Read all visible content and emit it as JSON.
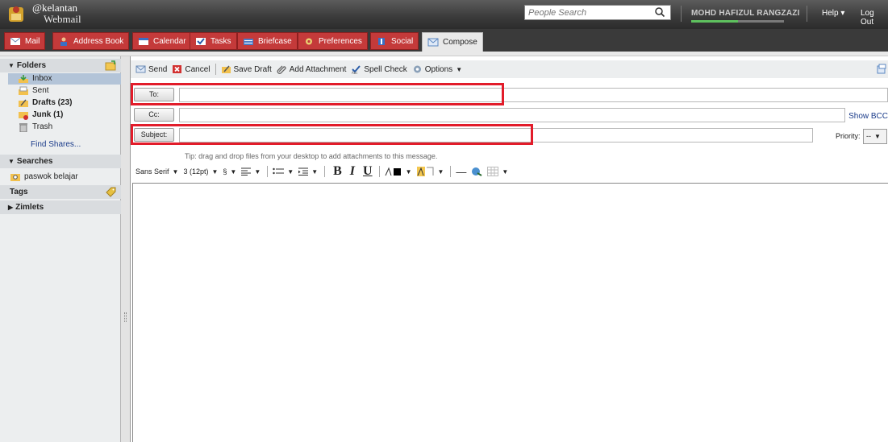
{
  "header": {
    "brand_line1": "@kelantan",
    "brand_line2": "Webmail",
    "people_search_placeholder": "People Search",
    "username": "MOHD HAFIZUL RANGZAZI",
    "quota_fraction": 0.5,
    "help_label": "Help ▾",
    "logout_label": "Log Out"
  },
  "tabs": [
    {
      "label": "Mail",
      "icon": "mail-icon"
    },
    {
      "label": "Address Book",
      "icon": "address-book-icon"
    },
    {
      "label": "Calendar",
      "icon": "calendar-icon"
    },
    {
      "label": "Tasks",
      "icon": "tasks-icon"
    },
    {
      "label": "Briefcase",
      "icon": "briefcase-icon"
    },
    {
      "label": "Preferences",
      "icon": "gear-icon"
    },
    {
      "label": "Social",
      "icon": "social-icon"
    },
    {
      "label": "Compose",
      "icon": "compose-icon",
      "active": true
    }
  ],
  "sidebar": {
    "folders_header": "Folders",
    "folders": [
      {
        "label": "Inbox",
        "icon": "inbox-icon",
        "selected": true
      },
      {
        "label": "Sent",
        "icon": "sent-icon"
      },
      {
        "label": "Drafts (23)",
        "icon": "drafts-icon",
        "bold": true
      },
      {
        "label": "Junk (1)",
        "icon": "junk-icon",
        "bold": true
      },
      {
        "label": "Trash",
        "icon": "trash-icon"
      }
    ],
    "find_shares": "Find Shares...",
    "searches_header": "Searches",
    "searches": [
      {
        "label": "paswok belajar",
        "icon": "saved-search-icon"
      }
    ],
    "tags_header": "Tags",
    "zimlets_header": "Zimlets"
  },
  "toolbar": {
    "send": "Send",
    "cancel": "Cancel",
    "save_draft": "Save Draft",
    "add_attachment": "Add Attachment",
    "spell_check": "Spell Check",
    "options": "Options"
  },
  "compose": {
    "to_label": "To:",
    "to_value": "",
    "cc_label": "Cc:",
    "cc_value": "",
    "show_bcc": "Show BCC",
    "subject_label": "Subject:",
    "subject_value": "",
    "priority_label": "Priority:",
    "priority_value": "--",
    "tip": "Tip: drag and drop files from your desktop to add attachments to this message."
  },
  "format_bar": {
    "font": "Sans Serif",
    "size": "3 (12pt)",
    "style_label": "§",
    "bold": "B",
    "italic": "I",
    "underline": "U",
    "hr": "—"
  },
  "colors": {
    "tab_red": "#c43a3a",
    "highlight_box": "#e21c2a",
    "selected_folder": "#b3c4d8"
  }
}
